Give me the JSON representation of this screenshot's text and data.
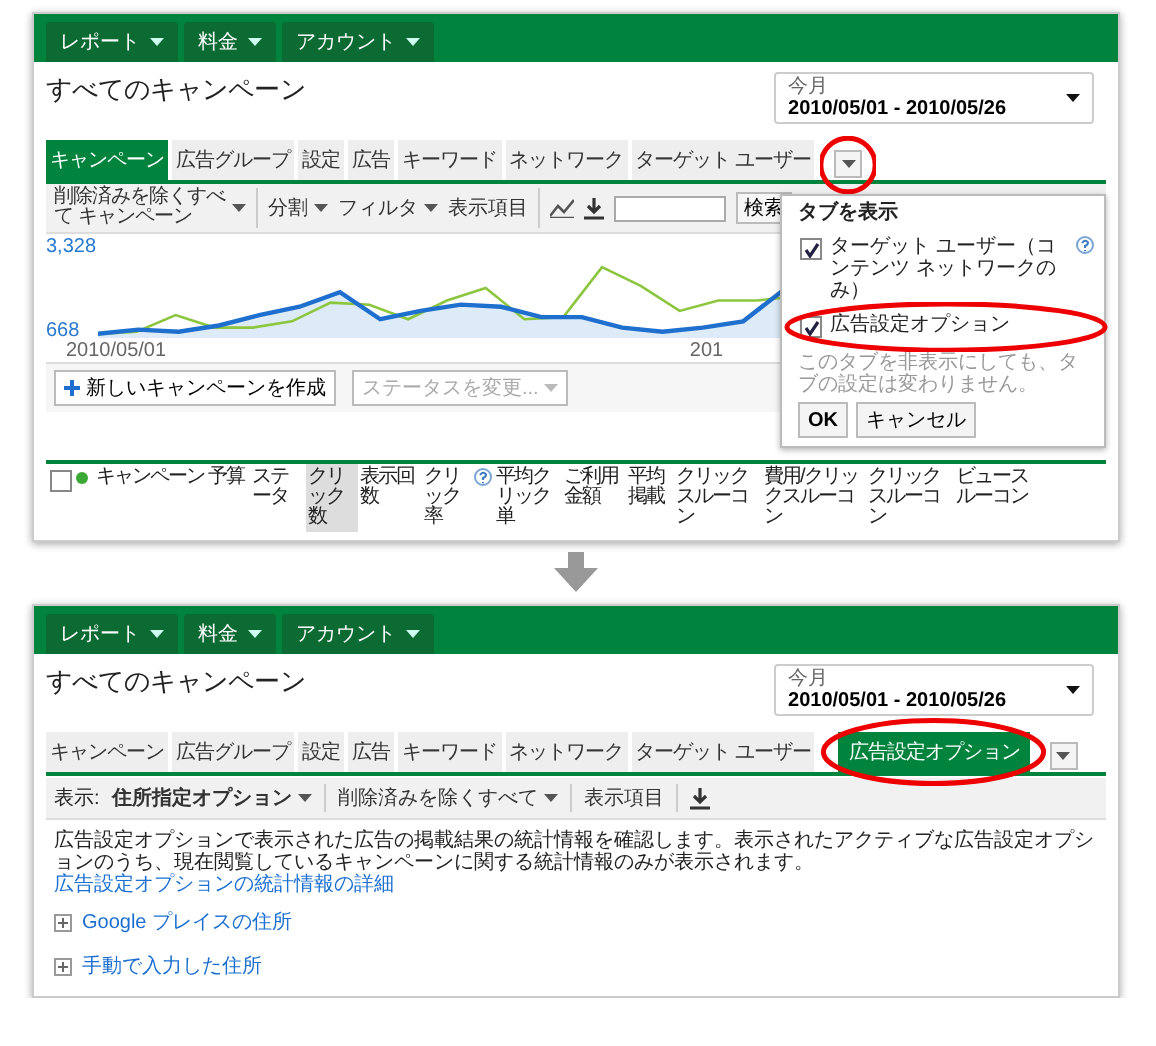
{
  "top_screen": {
    "nav_menus": [
      {
        "label": "レポート"
      },
      {
        "label": "料金"
      },
      {
        "label": "アカウント"
      }
    ],
    "page_title": "すべてのキャンペーン",
    "date_range": {
      "label": "今月",
      "value": "2010/05/01 - 2010/05/26"
    },
    "tabs": [
      {
        "label": "キャンペーン",
        "selected": true,
        "circled": false
      },
      {
        "label": "広告グループ",
        "selected": false,
        "circled": false
      },
      {
        "label": "設定",
        "selected": false,
        "circled": false
      },
      {
        "label": "広告",
        "selected": false,
        "circled": false
      },
      {
        "label": "キーワード",
        "selected": false,
        "circled": false
      },
      {
        "label": "ネットワーク",
        "selected": false,
        "circled": false
      },
      {
        "label": "ターゲット ユーザー",
        "selected": false,
        "circled": false
      }
    ],
    "tab_menu_button": {
      "circled": true
    },
    "toolbar": {
      "view_filter": "削除済みを除くすべて キャンペーン",
      "segment": "分割",
      "filter": "フィルタ",
      "columns": "表示項目",
      "search_button": "検索"
    },
    "chart": {
      "y_top_label": "3,328",
      "y_bottom_label": "668",
      "x_start_label": "2010/05/01",
      "x_end_label": "201"
    },
    "actions": {
      "create_button": "新しいキャンペーンを作成",
      "status_dropdown": {
        "label": "ステータスを変更...",
        "disabled": true
      }
    },
    "table_columns": [
      {
        "kind": "checkbox",
        "checked": false
      },
      {
        "kind": "status-dot"
      },
      {
        "kind": "text",
        "label": "キャンペーン",
        "sorted": false,
        "help": false
      },
      {
        "kind": "text",
        "label": "予算",
        "sorted": false,
        "help": false
      },
      {
        "kind": "text",
        "label": "ステータ",
        "sorted": false,
        "help": false
      },
      {
        "kind": "text",
        "label": "クリック数",
        "sorted": true,
        "help": false
      },
      {
        "kind": "text",
        "label": "表示回数",
        "sorted": false,
        "help": false
      },
      {
        "kind": "text",
        "label": "クリック率",
        "sorted": false,
        "help": true
      },
      {
        "kind": "text",
        "label": "平均クリック単",
        "sorted": false,
        "help": false
      },
      {
        "kind": "text",
        "label": "ご利用金額",
        "sorted": false,
        "help": false
      },
      {
        "kind": "text",
        "label": "平均掲載",
        "sorted": false,
        "help": false
      },
      {
        "kind": "text",
        "label": "クリックスルーコン",
        "sorted": false,
        "help": false
      },
      {
        "kind": "text",
        "label": "費用/クリックスルーコン",
        "sorted": false,
        "help": false
      },
      {
        "kind": "text",
        "label": "クリックスルーコン",
        "sorted": false,
        "help": false
      },
      {
        "kind": "text",
        "label": "ビュースルーコン",
        "sorted": false,
        "help": false
      }
    ],
    "tab_popup": {
      "title": "タブを表示",
      "options": [
        {
          "label": "ターゲット ユーザー（コンテンツ ネットワークのみ）",
          "checked": true,
          "help": true,
          "circled": false
        },
        {
          "label": "広告設定オプション",
          "checked": true,
          "help": false,
          "circled": true
        }
      ],
      "note": "このタブを非表示にしても、タブの設定は変わりません。",
      "buttons": [
        "OK",
        "キャンセル"
      ]
    }
  },
  "bottom_screen": {
    "nav_menus": [
      {
        "label": "レポート"
      },
      {
        "label": "料金"
      },
      {
        "label": "アカウント"
      }
    ],
    "page_title": "すべてのキャンペーン",
    "date_range": {
      "label": "今月",
      "value": "2010/05/01 - 2010/05/26"
    },
    "tabs": [
      {
        "label": "キャンペーン",
        "selected": false,
        "circled": false
      },
      {
        "label": "広告グループ",
        "selected": false,
        "circled": false
      },
      {
        "label": "設定",
        "selected": false,
        "circled": false
      },
      {
        "label": "広告",
        "selected": false,
        "circled": false
      },
      {
        "label": "キーワード",
        "selected": false,
        "circled": false
      },
      {
        "label": "ネットワーク",
        "selected": false,
        "circled": false
      },
      {
        "label": "ターゲット ユーザー",
        "selected": false,
        "circled": false
      },
      {
        "label": "広告設定オプション",
        "selected": true,
        "circled": true
      }
    ],
    "tab_menu_button": {
      "circled": false
    },
    "extension_toolbar": {
      "view_label": "表示:",
      "view_value": "住所指定オプション",
      "filter": "削除済みを除くすべて",
      "columns": "表示項目"
    },
    "description": "広告設定オプションで表示された広告の掲載結果の統計情報を確認します。表示されたアクティブな広告設定オプションのうち、現在閲覧しているキャンペーンに関する統計情報のみが表示されます。",
    "description_link": "広告設定オプションの統計情報の詳細",
    "sections": [
      {
        "label": "Google プレイスの住所",
        "expanded": false
      },
      {
        "label": "手動で入力した住所",
        "expanded": false
      }
    ]
  }
}
